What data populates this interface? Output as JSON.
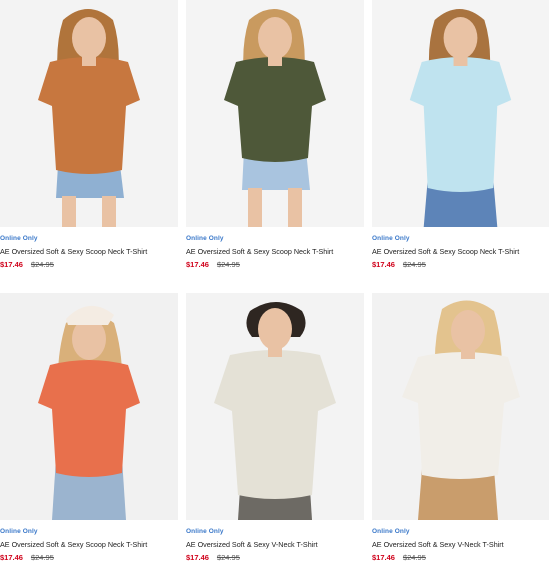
{
  "products": [
    {
      "badge": "Online Only",
      "name": "AE Oversized Soft & Sexy Scoop Neck T-Shirt",
      "sale_price": "$17.46",
      "original_price": "$24.95",
      "shirt_color": "#c7773f",
      "hair_color": "#b0743b",
      "bottom_color": "#8fb0d2",
      "bg_color": "#f3f3f3"
    },
    {
      "badge": "Online Only",
      "name": "AE Oversized Soft & Sexy Scoop Neck T-Shirt",
      "sale_price": "$17.46",
      "original_price": "$24.95",
      "shirt_color": "#4e5839",
      "hair_color": "#c99a5f",
      "bottom_color": "#a9c4df",
      "bg_color": "#f4f4f4"
    },
    {
      "badge": "Online Only",
      "name": "AE Oversized Soft & Sexy Scoop Neck T-Shirt",
      "sale_price": "$17.46",
      "original_price": "$24.95",
      "shirt_color": "#bfe3ef",
      "hair_color": "#a9733f",
      "bottom_color": "#5d84b8",
      "bg_color": "#f4f4f4"
    },
    {
      "badge": "Online Only",
      "name": "AE Oversized Soft & Sexy Scoop Neck T-Shirt",
      "sale_price": "$17.46",
      "original_price": "$24.95",
      "shirt_color": "#e8704c",
      "hair_color": "#d9b07a",
      "bottom_color": "#9bb4cf",
      "bg_color": "#f1f1f1"
    },
    {
      "badge": "Online Only",
      "name": "AE Oversized Soft & Sexy V-Neck T-Shirt",
      "sale_price": "$17.46",
      "original_price": "$24.95",
      "shirt_color": "#e4e1d6",
      "hair_color": "#2e2621",
      "bottom_color": "#6d6a64",
      "bg_color": "#f3f3f3"
    },
    {
      "badge": "Online Only",
      "name": "AE Oversized Soft & Sexy V-Neck T-Shirt",
      "sale_price": "$17.46",
      "original_price": "$24.95",
      "shirt_color": "#f1eee8",
      "hair_color": "#e3c38e",
      "bottom_color": "#c99d6c",
      "bg_color": "#f2f2f2"
    }
  ]
}
